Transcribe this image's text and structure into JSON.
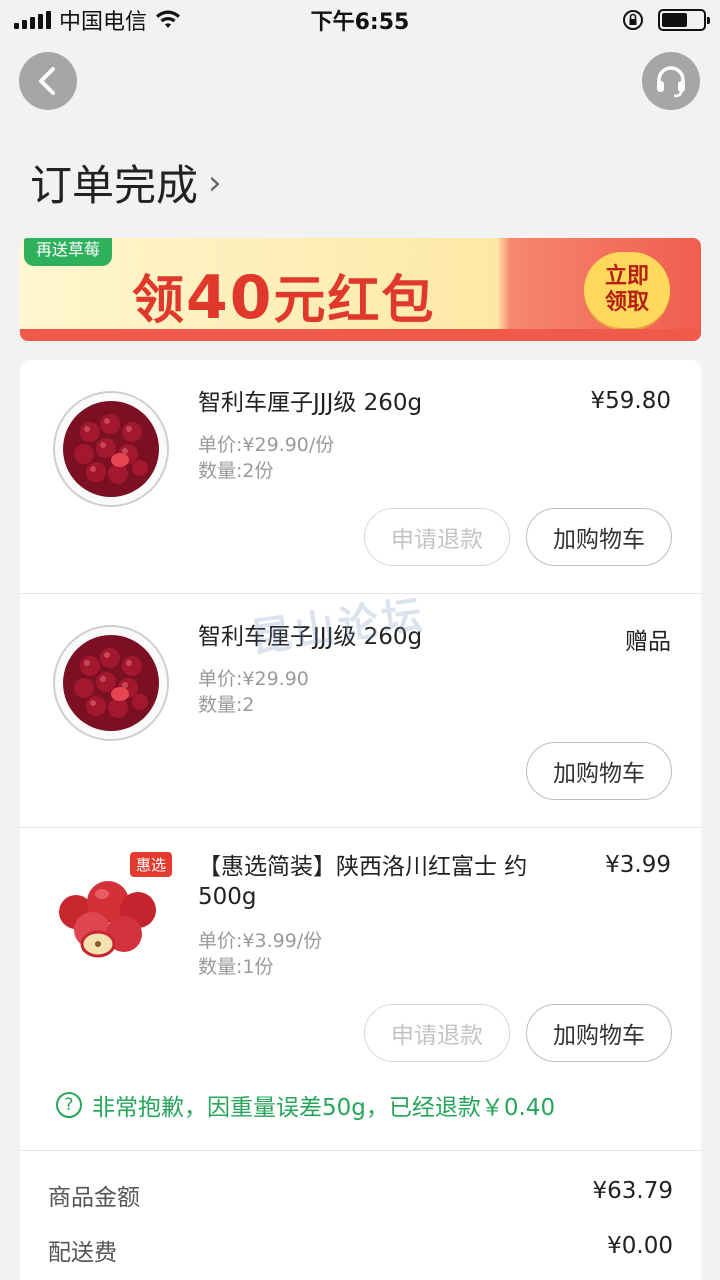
{
  "status_bar": {
    "carrier": "中国电信",
    "time": "下午6:55"
  },
  "header": {
    "title": "订单完成",
    "chevron": "›"
  },
  "banner": {
    "tag": "再送草莓",
    "text_prefix": "领",
    "amount": "40",
    "text_suffix": "元红包",
    "button_line1": "立即",
    "button_line2": "领取"
  },
  "items": [
    {
      "name": "智利车厘子JJJ级 260g",
      "price": "¥59.80",
      "unit_price": "单价:¥29.90/份",
      "quantity": "数量:2份",
      "refund_label": "申请退款",
      "cart_label": "加购物车"
    },
    {
      "name": "智利车厘子JJJ级 260g",
      "price": "赠品",
      "unit_price": "单价:¥29.90",
      "quantity": "数量:2",
      "cart_label": "加购物车"
    },
    {
      "name_line1": "【惠选简装】陕西洛川红富士 约",
      "name_line2": "500g",
      "badge": "惠选",
      "price": "¥3.99",
      "unit_price": "单价:¥3.99/份",
      "quantity": "数量:1份",
      "refund_label": "申请退款",
      "cart_label": "加购物车"
    }
  ],
  "notice": {
    "icon_text": "?",
    "text": "非常抱歉，因重量误差50g，已经退款￥0.40"
  },
  "summary": {
    "goods_label": "商品金额",
    "goods_value": "¥63.79",
    "delivery_label": "配送费",
    "delivery_value": "¥0.00"
  },
  "watermark": "昆山论坛",
  "colors": {
    "accent_green": "#27a55a",
    "banner_red": "#e0392b"
  }
}
